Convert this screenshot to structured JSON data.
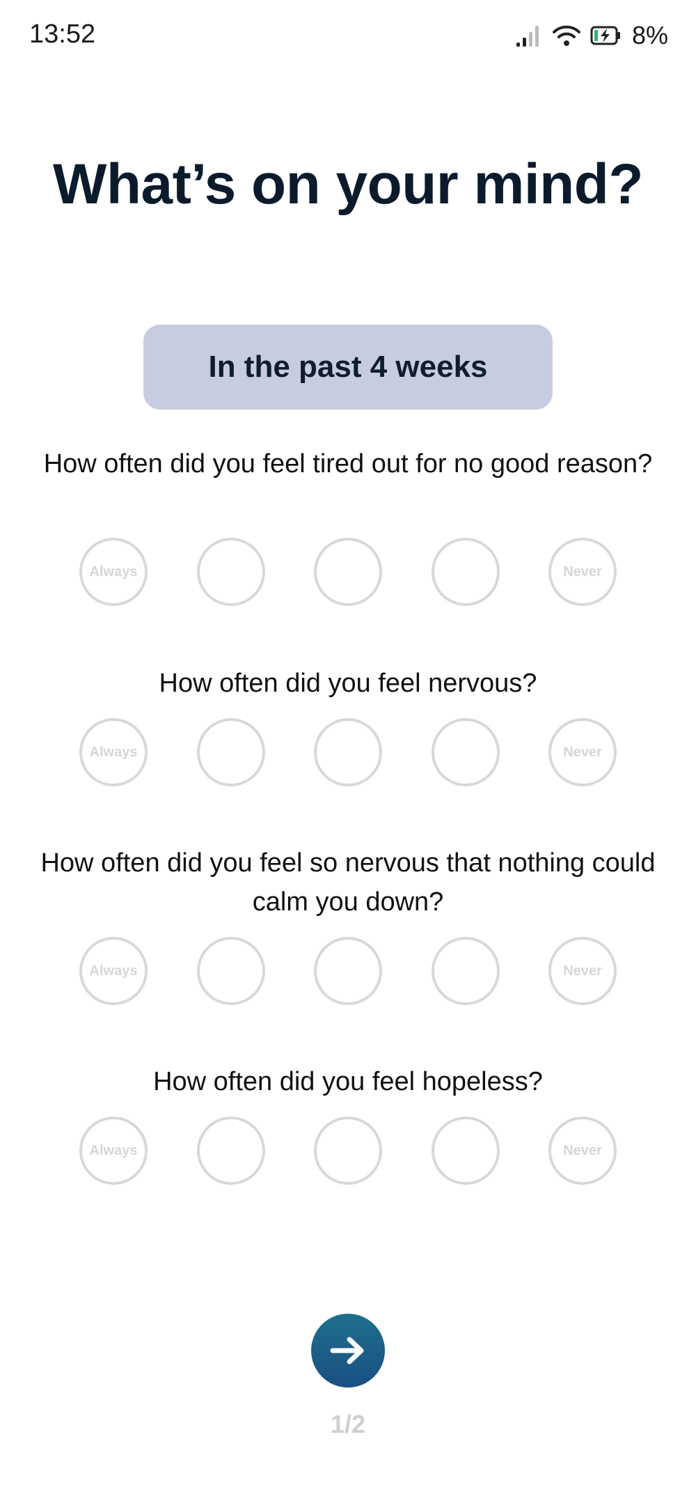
{
  "status_bar": {
    "time": "13:52",
    "battery_percent": "8%",
    "icons": [
      "signal-icon",
      "wifi-icon",
      "battery-charging-icon"
    ]
  },
  "header": {
    "title": "What’s on your mind?"
  },
  "period": {
    "label": "In the past 4 weeks"
  },
  "scale": {
    "first_label": "Always",
    "last_label": "Never",
    "option_count": 5
  },
  "questions": [
    {
      "text": "How often did  you feel tired out for no good reason?"
    },
    {
      "text": "How often did  you feel nervous?"
    },
    {
      "text": "How often did  you feel so nervous that nothing could  calm you down?"
    },
    {
      "text": "How often did  you feel hopeless?"
    }
  ],
  "navigation": {
    "next_icon": "arrow-right-icon",
    "page_indicator": "1/2"
  },
  "colors": {
    "title": "#0c1b2c",
    "pill_background": "#c8cce0",
    "option_border": "#d8d8d8",
    "next_button": "#1a5a86"
  }
}
